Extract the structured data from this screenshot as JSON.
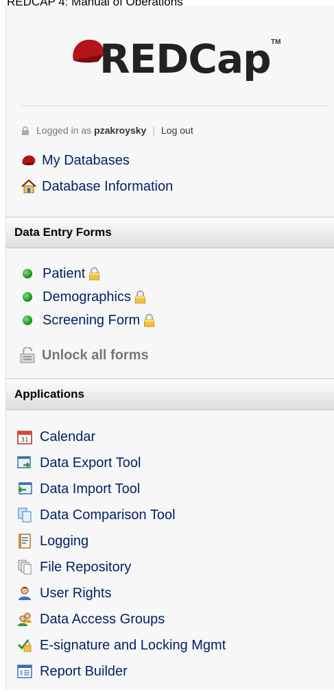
{
  "caption": "REDCAP 4: Manual of Operations",
  "logo": {
    "text": "REDCap",
    "tm": "TM"
  },
  "login": {
    "prefix": "Logged in as",
    "username": "pzakroysky",
    "separator": "|",
    "logout": "Log out"
  },
  "nav": [
    {
      "label": "My Databases",
      "icon": "red-cap-icon"
    },
    {
      "label": "Database Information",
      "icon": "home-icon"
    }
  ],
  "data_entry": {
    "header": "Data Entry Forms",
    "forms": [
      {
        "label": "Patient",
        "status": "green",
        "locked": true
      },
      {
        "label": "Demographics",
        "status": "green",
        "locked": true
      },
      {
        "label": "Screening Form",
        "status": "green",
        "locked": true
      }
    ],
    "unlock_all": "Unlock all forms"
  },
  "applications": {
    "header": "Applications",
    "items": [
      {
        "label": "Calendar",
        "icon": "calendar-icon"
      },
      {
        "label": "Data Export Tool",
        "icon": "export-icon"
      },
      {
        "label": "Data Import Tool",
        "icon": "import-icon"
      },
      {
        "label": "Data Comparison Tool",
        "icon": "compare-icon"
      },
      {
        "label": "Logging",
        "icon": "logging-icon"
      },
      {
        "label": "File Repository",
        "icon": "file-repository-icon"
      },
      {
        "label": "User Rights",
        "icon": "user-icon"
      },
      {
        "label": "Data Access Groups",
        "icon": "group-icon"
      },
      {
        "label": "E-signature and Locking Mgmt",
        "icon": "esignature-icon"
      },
      {
        "label": "Report Builder",
        "icon": "report-icon"
      }
    ]
  },
  "colors": {
    "link": "#002266",
    "status_green": "#128a12",
    "brand_red": "#c0141c"
  }
}
